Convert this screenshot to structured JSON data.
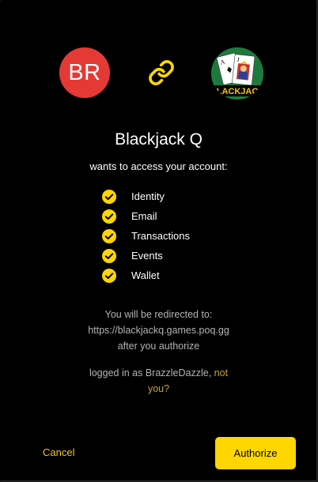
{
  "user": {
    "initials": "BR",
    "avatar_color": "#e53935"
  },
  "icons": {
    "link": "link-icon",
    "check": "check-circle-icon",
    "app_logo": "blackjack-card-logo"
  },
  "app": {
    "name": "Blackjack Q",
    "logo_text": "BLACKJACK"
  },
  "request": {
    "subtitle": "wants to access your account:"
  },
  "permissions": [
    "Identity",
    "Email",
    "Transactions",
    "Events",
    "Wallet"
  ],
  "redirect": {
    "line1": "You will be redirected to:",
    "url": "https://blackjackq.games.poq.gg",
    "line3": "after you authorize"
  },
  "session": {
    "logged_in_prefix": "logged in as BrazzleDazzle,",
    "not_you_label": "not you?"
  },
  "actions": {
    "cancel_label": "Cancel",
    "authorize_label": "Authorize"
  },
  "colors": {
    "accent": "#ffd600",
    "link_text": "#c9a227",
    "cancel_text": "#f5c518",
    "background": "#000000",
    "muted_text": "#b3b3b3"
  }
}
